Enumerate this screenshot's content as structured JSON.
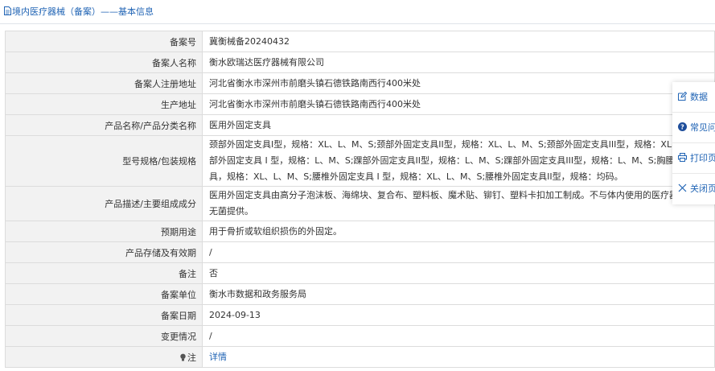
{
  "header": {
    "title": "境内医疗器械（备案）——基本信息"
  },
  "rows": [
    {
      "label": "备案号",
      "value": "冀衡械备20240432"
    },
    {
      "label": "备案人名称",
      "value": "衡水欧瑞达医疗器械有限公司"
    },
    {
      "label": "备案人注册地址",
      "value": "河北省衡水市深州市前磨头镇石德铁路南西行400米处"
    },
    {
      "label": "生产地址",
      "value": "河北省衡水市深州市前磨头镇石德铁路南西行400米处"
    },
    {
      "label": "产品名称/产品分类名称",
      "value": "医用外固定支具"
    },
    {
      "label": "型号规格/包装规格",
      "lines": [
        "颈部外固定支具I型，规格：XL、L、M、S;颈部外固定支具II型，规格：XL、L、M、S;颈部外固定支具III型，规格：XL、L、M、S",
        "部外固定支具 I 型，规格：L、M、S;踝部外固定支具II型，规格：L、M、S;踝部外固定支具III型，规格：L、M、S;胸腰椎外固定支",
        "具，规格：XL、L、M、S;腰椎外固定支具 I 型，规格：XL、L、M、S;腰椎外固定支具II型，规格：均码。"
      ]
    },
    {
      "label": "产品描述/主要组成成分",
      "lines": [
        "医用外固定支具由高分子泡沫板、海绵块、复合布、塑料板、魔术贴、铆钉、塑料卡扣加工制成。不与体内使用的医疗器械连接",
        "无菌提供。"
      ]
    },
    {
      "label": "预期用途",
      "value": "用于骨折或软组织损伤的外固定。"
    },
    {
      "label": "产品存储及有效期",
      "value": "/"
    },
    {
      "label": "备注",
      "value": "否"
    },
    {
      "label": "备案单位",
      "value": "衡水市数据和政务服务局"
    },
    {
      "label": "备案日期",
      "value": "2024-09-13"
    },
    {
      "label": "变更情况",
      "value": "/"
    },
    {
      "label": "注",
      "value": "详情"
    }
  ],
  "float_menu": {
    "items": [
      {
        "label": "数据",
        "icon": "edit-icon"
      },
      {
        "label": "常见问",
        "icon": "help-icon"
      },
      {
        "label": "打印页",
        "icon": "print-icon"
      },
      {
        "label": "关闭页",
        "icon": "close-icon"
      }
    ]
  },
  "colors": {
    "accent": "#1f63b4",
    "label_bg": "#f2f2f2",
    "border": "#dcdcdc"
  }
}
